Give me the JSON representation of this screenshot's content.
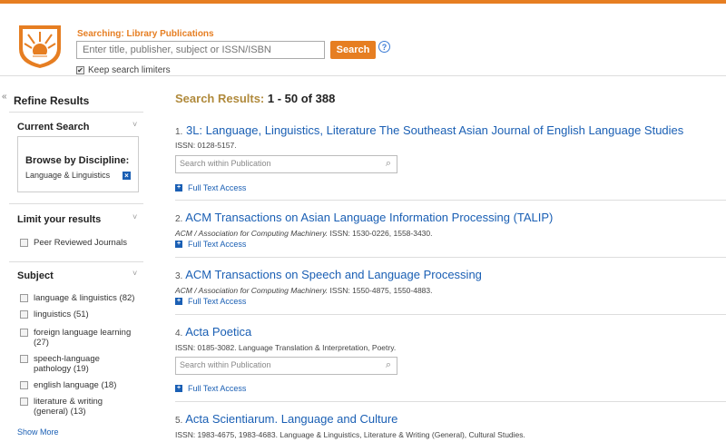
{
  "header": {
    "searching_label": "Searching: Library Publications",
    "search_placeholder": "Enter title, publisher, subject or ISSN/ISBN",
    "search_button": "Search",
    "help": "?",
    "keep_limiters": "Keep search limiters"
  },
  "sidebar": {
    "collapse": "«",
    "title": "Refine Results",
    "current_search": "Current Search",
    "browse_title": "Browse by Discipline:",
    "browse_value": "Language & Linguistics",
    "limit_title": "Limit your results",
    "limit_option": "Peer Reviewed Journals",
    "subject_title": "Subject",
    "subjects": [
      {
        "label": "language & linguistics (82)"
      },
      {
        "label": "linguistics (51)"
      },
      {
        "label": "foreign language learning (27)"
      },
      {
        "label": "speech-language pathology (19)"
      },
      {
        "label": "english language (18)"
      },
      {
        "label": "literature & writing (general) (13)"
      }
    ],
    "show_more": "Show More"
  },
  "results": {
    "heading_label": "Search Results:",
    "heading_range": "1 - 50 of 388",
    "within_placeholder": "Search within Publication",
    "full_text": "Full Text Access",
    "items": [
      {
        "num": "1.",
        "title": "3L: Language, Linguistics, Literature The Southeast Asian Journal of English Language Studies",
        "meta": "ISSN: 0128-5157."
      },
      {
        "num": "2.",
        "title": "ACM Transactions on Asian Language Information Processing (TALIP)",
        "publisher": "ACM / Association for Computing Machinery.",
        "meta": " ISSN: 1530-0226, 1558-3430."
      },
      {
        "num": "3.",
        "title": "ACM Transactions on Speech and Language Processing",
        "publisher": "ACM / Association for Computing Machinery.",
        "meta": " ISSN: 1550-4875, 1550-4883."
      },
      {
        "num": "4.",
        "title": "Acta Poetica",
        "meta": "ISSN: 0185-3082. Language Translation & Interpretation, Poetry."
      },
      {
        "num": "5.",
        "title": "Acta Scientiarum. Language and Culture",
        "meta": "ISSN: 1983-4675, 1983-4683. Language & Linguistics, Literature & Writing (General), Cultural Studies."
      }
    ]
  },
  "colors": {
    "accent": "#e67e22",
    "link": "#1a5fb4",
    "heading": "#b08a3c"
  }
}
